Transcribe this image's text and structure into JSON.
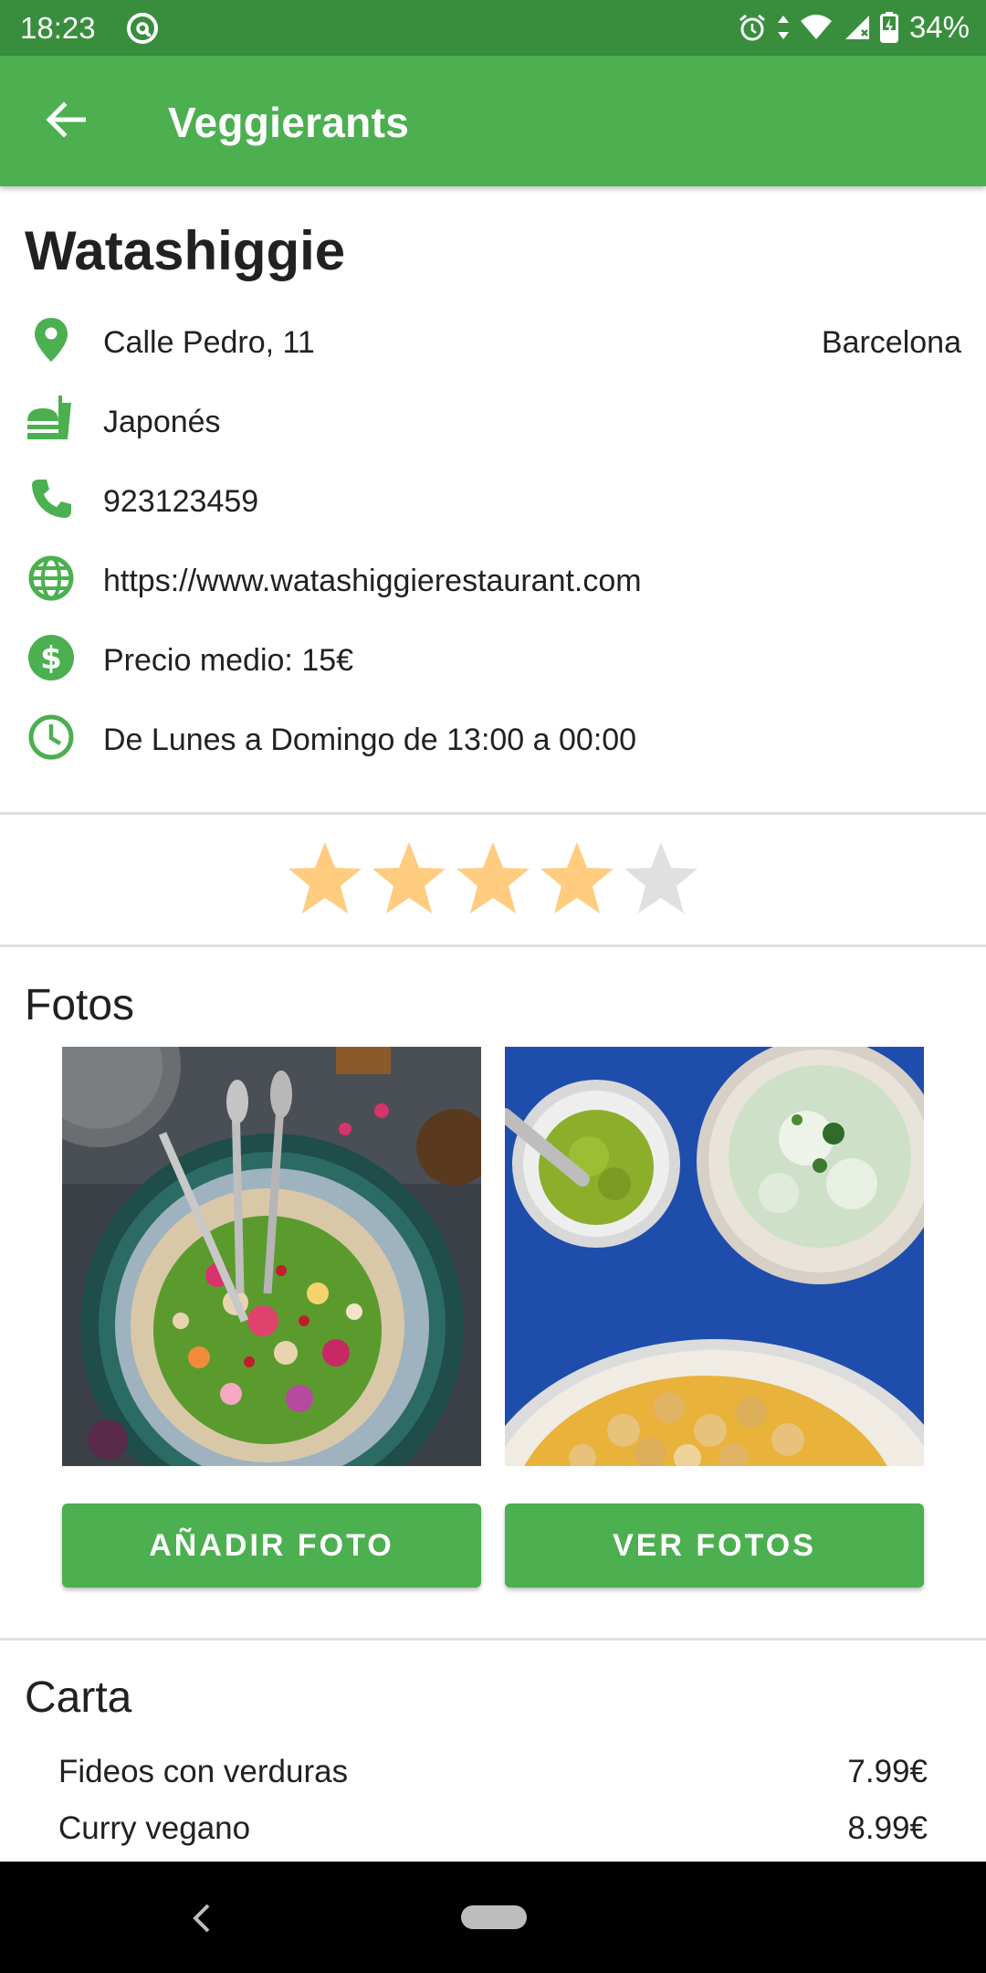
{
  "status_bar": {
    "time": "18:23",
    "battery_percent": "34%",
    "icons": [
      "at-icon",
      "alarm-icon",
      "data-arrows-icon",
      "wifi-icon",
      "signal-icon",
      "battery-charging-icon"
    ]
  },
  "app_bar": {
    "title": "Veggierants",
    "back_icon": "arrow-back-icon"
  },
  "restaurant": {
    "name": "Watashiggie",
    "address": "Calle Pedro, 11",
    "city": "Barcelona",
    "cuisine": "Japonés",
    "phone": "923123459",
    "website": "https://www.watashiggierestaurant.com",
    "price": "Precio medio: 15€",
    "hours": "De Lunes a Domingo de 13:00 a 00:00"
  },
  "rating": {
    "value": 4,
    "max": 5,
    "filled_color": "#ffcc80",
    "empty_color": "#e0e0e0"
  },
  "photos": {
    "title": "Fotos",
    "add_button": "AÑADIR FOTO",
    "view_button": "VER FOTOS"
  },
  "menu": {
    "title": "Carta",
    "items": [
      {
        "name": "Fideos con verduras",
        "price": "7.99€"
      },
      {
        "name": "Curry vegano",
        "price": "8.99€"
      }
    ]
  },
  "colors": {
    "primary": "#4caf50",
    "primary_dark": "#388e3c",
    "icon_green": "#4caf50"
  }
}
